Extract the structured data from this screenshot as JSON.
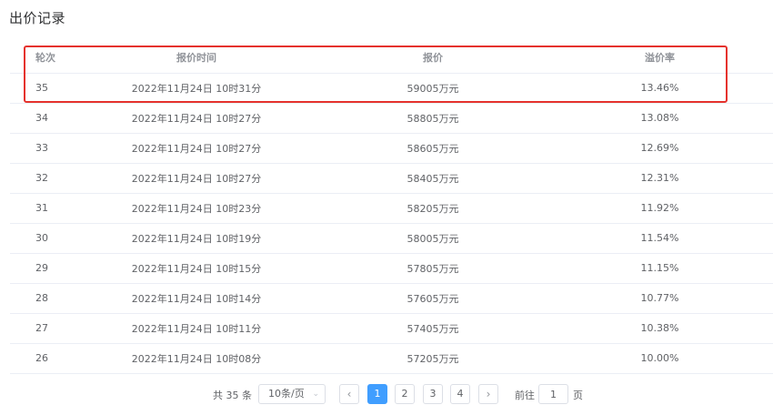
{
  "title": "出价记录",
  "table": {
    "headers": [
      "轮次",
      "报价时间",
      "报价",
      "溢价率"
    ],
    "rows": [
      {
        "round": "35",
        "time": "2022年11月24日 10时31分",
        "price": "59005万元",
        "rate": "13.46%"
      },
      {
        "round": "34",
        "time": "2022年11月24日 10时27分",
        "price": "58805万元",
        "rate": "13.08%"
      },
      {
        "round": "33",
        "time": "2022年11月24日 10时27分",
        "price": "58605万元",
        "rate": "12.69%"
      },
      {
        "round": "32",
        "time": "2022年11月24日 10时27分",
        "price": "58405万元",
        "rate": "12.31%"
      },
      {
        "round": "31",
        "time": "2022年11月24日 10时23分",
        "price": "58205万元",
        "rate": "11.92%"
      },
      {
        "round": "30",
        "time": "2022年11月24日 10时19分",
        "price": "58005万元",
        "rate": "11.54%"
      },
      {
        "round": "29",
        "time": "2022年11月24日 10时15分",
        "price": "57805万元",
        "rate": "11.15%"
      },
      {
        "round": "28",
        "time": "2022年11月24日 10时14分",
        "price": "57605万元",
        "rate": "10.77%"
      },
      {
        "round": "27",
        "time": "2022年11月24日 10时11分",
        "price": "57405万元",
        "rate": "10.38%"
      },
      {
        "round": "26",
        "time": "2022年11月24日 10时08分",
        "price": "57205万元",
        "rate": "10.00%"
      }
    ]
  },
  "pagination": {
    "total_text": "共 35 条",
    "page_size": "10条/页",
    "prev_icon": "chevron-left-icon",
    "next_icon": "chevron-right-icon",
    "pages": [
      "1",
      "2",
      "3",
      "4"
    ],
    "current_page": "1",
    "goto_label": "前往",
    "goto_value": "1",
    "goto_suffix": "页"
  },
  "colors": {
    "highlight_border": "#e5322d",
    "active_page": "#409eff"
  }
}
